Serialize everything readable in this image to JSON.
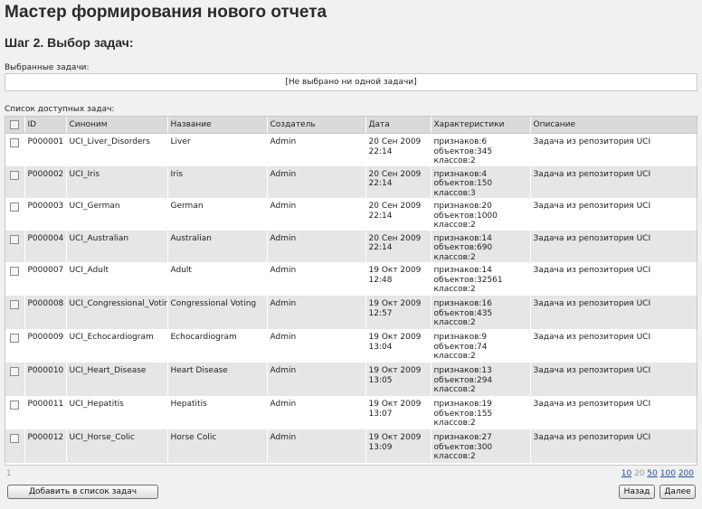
{
  "page": {
    "title": "Мастер формирования нового отчета",
    "step": "Шаг 2. Выбор задач:"
  },
  "selected": {
    "label": "Выбранные задачи:",
    "empty_text": "[Не выбрано ни одной задачи]"
  },
  "available": {
    "label": "Список доступных задач:",
    "columns": [
      "ID",
      "Синоним",
      "Название",
      "Создатель",
      "Дата",
      "Характеристики",
      "Описание"
    ],
    "rows": [
      {
        "id": "P000001",
        "synonym": "UCI_Liver_Disorders",
        "name": "Liver",
        "creator": "Admin",
        "date": "20 Сен 2009",
        "time": "22:14",
        "features": "признаков:6",
        "objects": "объектов:345",
        "classes": "классов:2",
        "description": "Задача из репозитория UCI"
      },
      {
        "id": "P000002",
        "synonym": "UCI_Iris",
        "name": "Iris",
        "creator": "Admin",
        "date": "20 Сен 2009",
        "time": "22:14",
        "features": "признаков:4",
        "objects": "объектов:150",
        "classes": "классов:3",
        "description": "Задача из репозитория UCI"
      },
      {
        "id": "P000003",
        "synonym": "UCI_German",
        "name": "German",
        "creator": "Admin",
        "date": "20 Сен 2009",
        "time": "22:14",
        "features": "признаков:20",
        "objects": "объектов:1000",
        "classes": "классов:2",
        "description": "Задача из репозитория UCI"
      },
      {
        "id": "P000004",
        "synonym": "UCI_Australian",
        "name": "Australian",
        "creator": "Admin",
        "date": "20 Сен 2009",
        "time": "22:14",
        "features": "признаков:14",
        "objects": "объектов:690",
        "classes": "классов:2",
        "description": "Задача из репозитория UCI"
      },
      {
        "id": "P000007",
        "synonym": "UCI_Adult",
        "name": "Adult",
        "creator": "Admin",
        "date": "19 Окт 2009",
        "time": "12:48",
        "features": "признаков:14",
        "objects": "объектов:32561",
        "classes": "классов:2",
        "description": "Задача из репозитория UCI"
      },
      {
        "id": "P000008",
        "synonym": "UCI_Congressional_Voting",
        "name": "Congressional Voting",
        "creator": "Admin",
        "date": "19 Окт 2009",
        "time": "12:57",
        "features": "признаков:16",
        "objects": "объектов:435",
        "classes": "классов:2",
        "description": "Задача из репозитория UCI"
      },
      {
        "id": "P000009",
        "synonym": "UCI_Echocardiogram",
        "name": "Echocardiogram",
        "creator": "Admin",
        "date": "19 Окт 2009",
        "time": "13:04",
        "features": "признаков:9",
        "objects": "объектов:74",
        "classes": "классов:2",
        "description": "Задача из репозитория UCI"
      },
      {
        "id": "P000010",
        "synonym": "UCI_Heart_Disease",
        "name": "Heart Disease",
        "creator": "Admin",
        "date": "19 Окт 2009",
        "time": "13:05",
        "features": "признаков:13",
        "objects": "объектов:294",
        "classes": "классов:2",
        "description": "Задача из репозитория UCI"
      },
      {
        "id": "P000011",
        "synonym": "UCI_Hepatitis",
        "name": "Hepatitis",
        "creator": "Admin",
        "date": "19 Окт 2009",
        "time": "13:07",
        "features": "признаков:19",
        "objects": "объектов:155",
        "classes": "классов:2",
        "description": "Задача из репозитория UCI"
      },
      {
        "id": "P000012",
        "synonym": "UCI_Horse_Colic",
        "name": "Horse Colic",
        "creator": "Admin",
        "date": "19 Окт 2009",
        "time": "13:09",
        "features": "признаков:27",
        "objects": "объектов:300",
        "classes": "классов:2",
        "description": "Задача из репозитория UCI"
      }
    ]
  },
  "pager": {
    "current_page": "1",
    "sizes": [
      "10",
      "20",
      "50",
      "100",
      "200"
    ],
    "active_size": "20"
  },
  "buttons": {
    "add": "Добавить в список задач",
    "back": "Назад",
    "next": "Далее"
  }
}
